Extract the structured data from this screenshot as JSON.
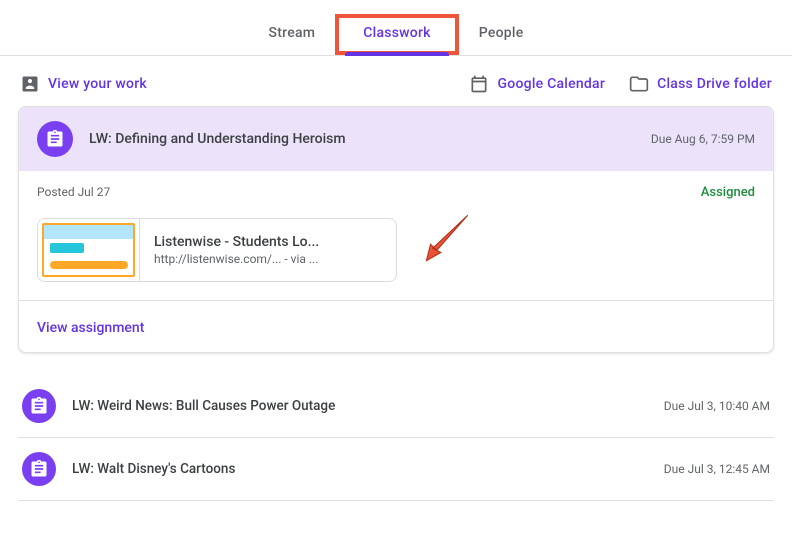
{
  "tabs": {
    "stream": "Stream",
    "classwork": "Classwork",
    "people": "People"
  },
  "utility": {
    "viewWork": "View your work",
    "calendar": "Google Calendar",
    "drive": "Class Drive folder"
  },
  "expanded": {
    "title": "LW: Defining and Understanding Heroism",
    "due": "Due Aug 6, 7:59 PM",
    "posted": "Posted Jul 27",
    "status": "Assigned",
    "attachment": {
      "title": "Listenwise - Students Lo...",
      "url": "http://listenwise.com/...",
      "suffix": " - via ..."
    },
    "viewAssignment": "View assignment"
  },
  "items": [
    {
      "title": "LW: Weird News: Bull Causes Power Outage",
      "due": "Due Jul 3, 10:40 AM"
    },
    {
      "title": "LW: Walt Disney's Cartoons",
      "due": "Due Jul 3, 12:45 AM"
    }
  ]
}
